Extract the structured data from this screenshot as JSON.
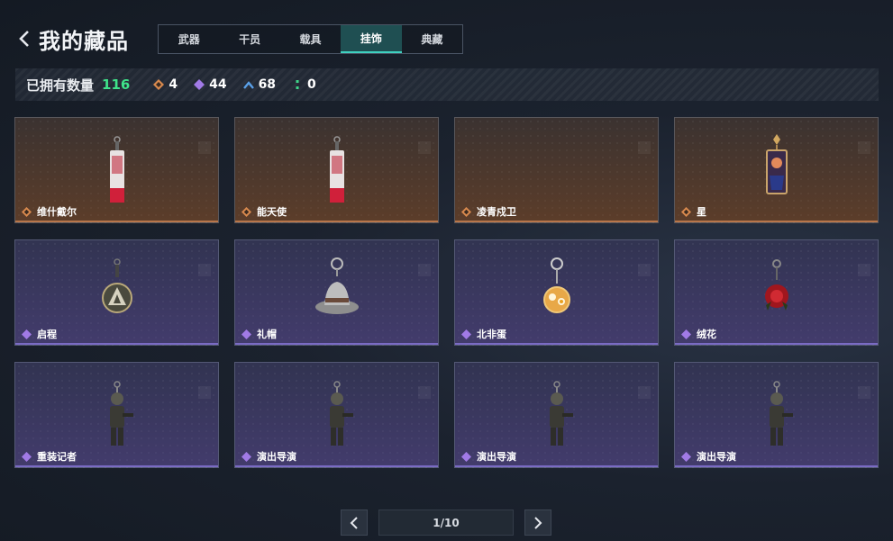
{
  "header": {
    "title": "我的藏品"
  },
  "tabs": [
    {
      "label": "武器",
      "active": false
    },
    {
      "label": "干员",
      "active": false
    },
    {
      "label": "载具",
      "active": false
    },
    {
      "label": "挂饰",
      "active": true
    },
    {
      "label": "典藏",
      "active": false
    }
  ],
  "stats": {
    "label": "已拥有数量",
    "total": "116",
    "items": [
      {
        "icon": "orange-diamond-icon",
        "color": "#d98a4e",
        "value": "4"
      },
      {
        "icon": "purple-diamond-icon",
        "color": "#a17ae6",
        "value": "44"
      },
      {
        "icon": "blue-chevron-icon",
        "color": "#5aa0e8",
        "value": "68"
      },
      {
        "icon": "green-dots-icon",
        "color": "#3fd68a",
        "value": "0"
      }
    ]
  },
  "items": [
    {
      "name": "维什戴尔",
      "rarity": "orange",
      "art": "bottle-charm"
    },
    {
      "name": "能天使",
      "rarity": "orange",
      "art": "bottle-charm"
    },
    {
      "name": "凌青戍卫",
      "rarity": "orange",
      "art": "none"
    },
    {
      "name": "星",
      "rarity": "orange",
      "art": "card-charm"
    },
    {
      "name": "启程",
      "rarity": "purple",
      "art": "medal-charm"
    },
    {
      "name": "礼帽",
      "rarity": "purple",
      "art": "hat-charm"
    },
    {
      "name": "北非蛋",
      "rarity": "purple",
      "art": "egg-charm"
    },
    {
      "name": "绒花",
      "rarity": "purple",
      "art": "rose-charm"
    },
    {
      "name": "重装记者",
      "rarity": "purple",
      "art": "figure-charm"
    },
    {
      "name": "演出导演",
      "rarity": "purple",
      "art": "figure-charm"
    },
    {
      "name": "演出导演",
      "rarity": "purple",
      "art": "figure-charm"
    },
    {
      "name": "演出导演",
      "rarity": "purple",
      "art": "figure-charm"
    }
  ],
  "pager": {
    "label": "1/10"
  }
}
